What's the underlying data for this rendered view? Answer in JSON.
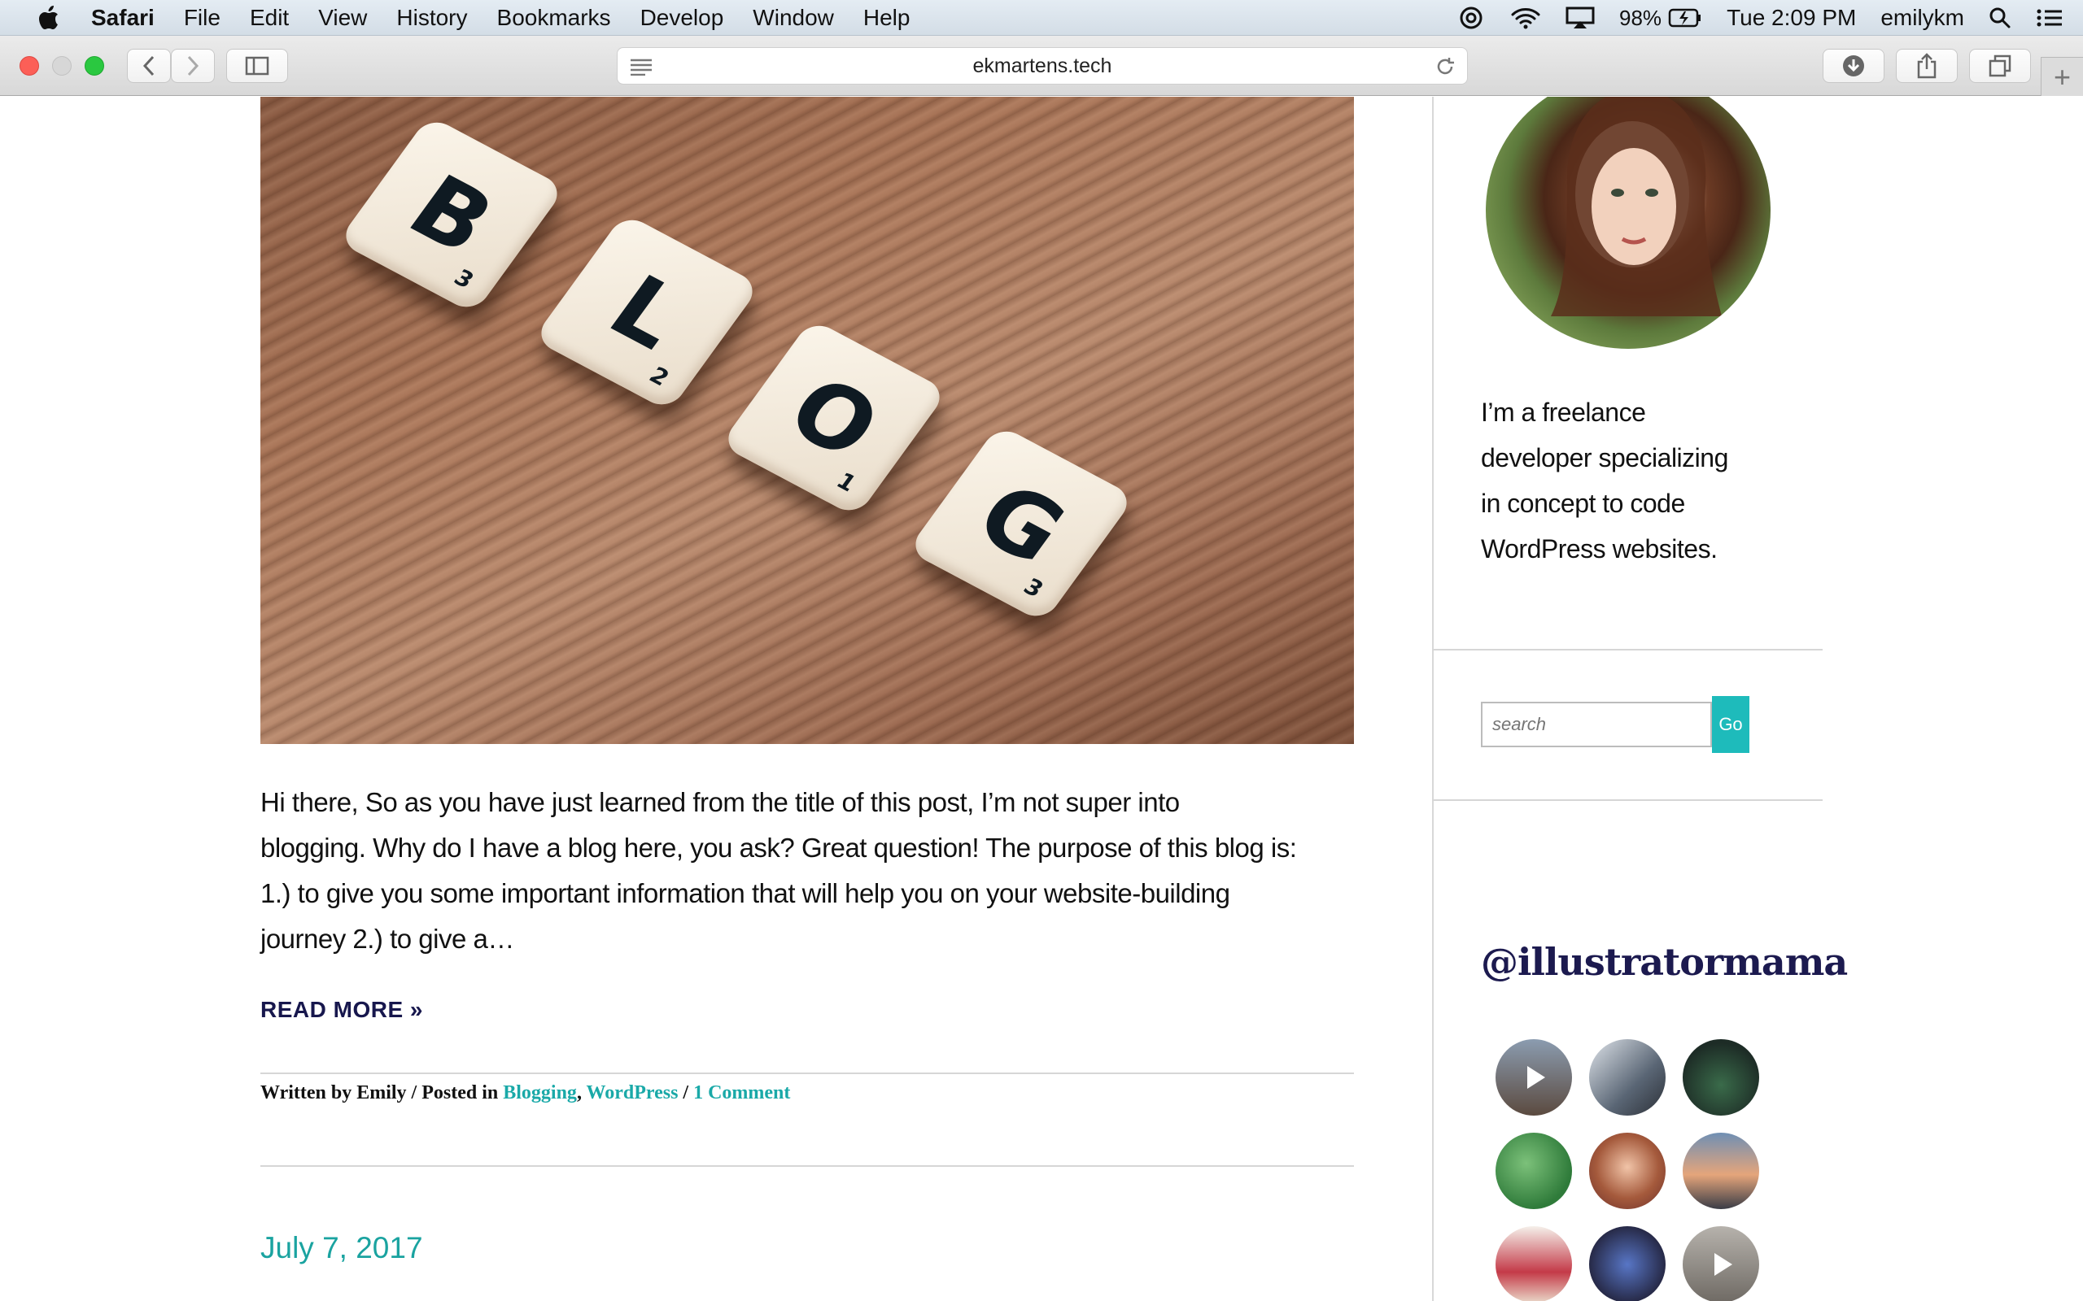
{
  "menubar": {
    "app_name": "Safari",
    "items": [
      "File",
      "Edit",
      "View",
      "History",
      "Bookmarks",
      "Develop",
      "Window",
      "Help"
    ],
    "battery": "98%",
    "clock": "Tue 2:09 PM",
    "user": "emilykm"
  },
  "browser": {
    "url": "ekmartens.tech"
  },
  "post": {
    "hero_tiles": [
      {
        "letter": "B",
        "sub": "3"
      },
      {
        "letter": "L",
        "sub": "2"
      },
      {
        "letter": "O",
        "sub": "1"
      },
      {
        "letter": "G",
        "sub": "3"
      }
    ],
    "excerpt_lines": [
      "Hi there, So as you have just learned from the title of this post, I’m not super into",
      "blogging. Why do I have a blog here, you ask? Great question! The purpose of this blog is:",
      "1.) to give you some important information that will help you on your website-building",
      "journey 2.) to give a…"
    ],
    "read_more": "READ MORE »",
    "meta_written": "Written by Emily / Posted in ",
    "meta_cat1": "Blogging",
    "meta_comma": ", ",
    "meta_cat2": "WordPress",
    "meta_sep": " / ",
    "meta_comments": "1 Comment",
    "next_date": "July 7, 2017"
  },
  "sidebar": {
    "bio_lines": [
      "I’m a freelance",
      "developer specializing",
      "in concept to code",
      "WordPress websites."
    ],
    "search_placeholder": "search",
    "go_label": "Go",
    "instagram_handle": "@illustratormama"
  },
  "colors": {
    "accent_teal": "#1aa9a8",
    "go_button": "#1ebbbb",
    "heading_navy": "#1c1a4f"
  }
}
